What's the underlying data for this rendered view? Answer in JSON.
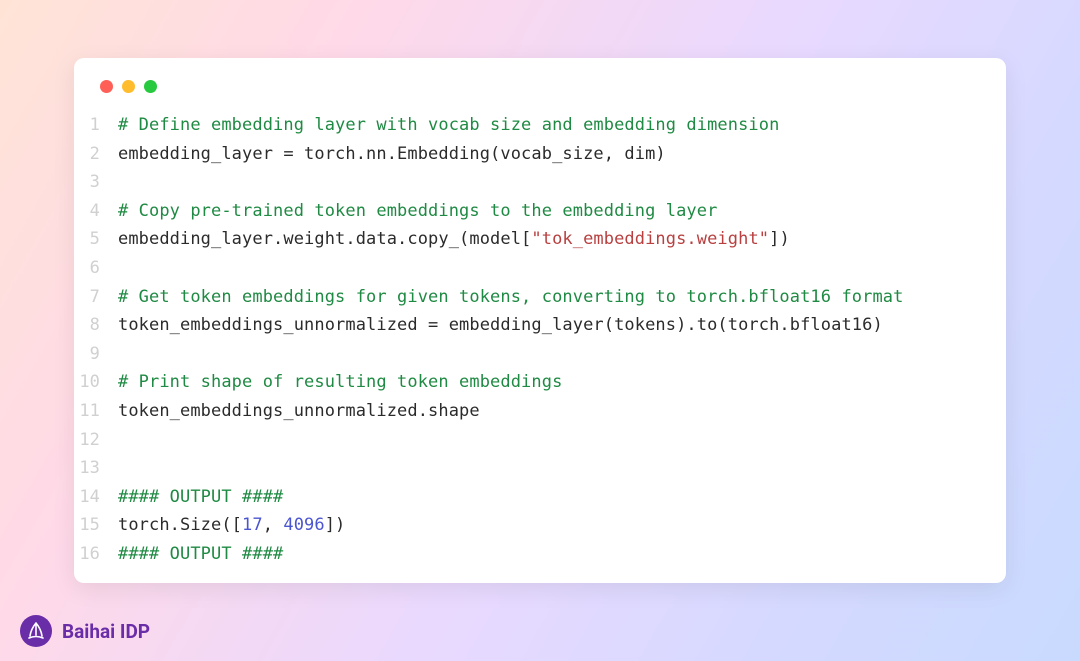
{
  "brand": {
    "name": "Baihai IDP"
  },
  "window": {
    "dots": [
      "red",
      "yellow",
      "green"
    ]
  },
  "code": {
    "lines": [
      {
        "n": 1,
        "tokens": [
          {
            "t": "# Define embedding layer with vocab size and embedding dimension",
            "cls": "c-comment"
          }
        ]
      },
      {
        "n": 2,
        "tokens": [
          {
            "t": "embedding_layer = torch.nn.Embedding(vocab_size, dim)"
          }
        ]
      },
      {
        "n": 3,
        "tokens": []
      },
      {
        "n": 4,
        "tokens": [
          {
            "t": "# Copy pre-trained token embeddings to the embedding layer",
            "cls": "c-comment"
          }
        ]
      },
      {
        "n": 5,
        "tokens": [
          {
            "t": "embedding_layer.weight.data.copy_(model["
          },
          {
            "t": "\"tok_embeddings.weight\"",
            "cls": "c-string"
          },
          {
            "t": "])"
          }
        ]
      },
      {
        "n": 6,
        "tokens": []
      },
      {
        "n": 7,
        "tokens": [
          {
            "t": "# Get token embeddings for given tokens, converting to torch.bfloat16 format",
            "cls": "c-comment"
          }
        ]
      },
      {
        "n": 8,
        "tokens": [
          {
            "t": "token_embeddings_unnormalized = embedding_layer(tokens).to(torch.bfloat16)"
          }
        ]
      },
      {
        "n": 9,
        "tokens": []
      },
      {
        "n": 10,
        "tokens": [
          {
            "t": "# Print shape of resulting token embeddings",
            "cls": "c-comment"
          }
        ]
      },
      {
        "n": 11,
        "tokens": [
          {
            "t": "token_embeddings_unnormalized.shape"
          }
        ]
      },
      {
        "n": 12,
        "tokens": []
      },
      {
        "n": 13,
        "tokens": []
      },
      {
        "n": 14,
        "tokens": [
          {
            "t": "#### OUTPUT ####",
            "cls": "c-comment"
          }
        ]
      },
      {
        "n": 15,
        "tokens": [
          {
            "t": "torch.Size(["
          },
          {
            "t": "17",
            "cls": "c-number"
          },
          {
            "t": ", "
          },
          {
            "t": "4096",
            "cls": "c-number"
          },
          {
            "t": "])"
          }
        ]
      },
      {
        "n": 16,
        "tokens": [
          {
            "t": "#### OUTPUT ####",
            "cls": "c-comment"
          }
        ]
      }
    ]
  }
}
